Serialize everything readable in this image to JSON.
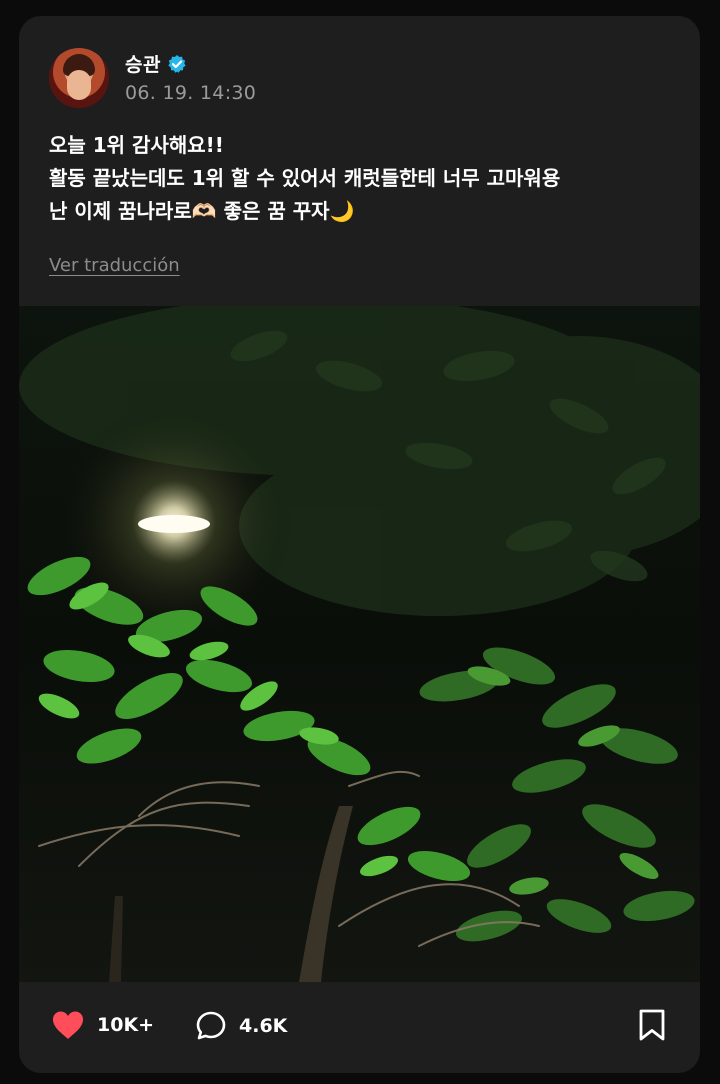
{
  "post": {
    "username": "승관",
    "verified": true,
    "timestamp": "06. 19. 14:30",
    "text_lines": [
      "오늘 1위 감사해요!!",
      "활동 끝났는데도 1위 할 수 있어서 캐럿들한테 너무 고마워용",
      "난 이제 꿈나라로🫶🏻 좋은 꿈 꾸자🌙"
    ],
    "translate_link": "Ver traducción",
    "photo_description_icon": "night-tree-lamp-photo"
  },
  "actions": {
    "like_count": "10K+",
    "comment_count": "4.6K",
    "like_icon": "heart-icon",
    "comment_icon": "comment-bubble-icon",
    "bookmark_icon": "bookmark-icon"
  },
  "colors": {
    "background": "#0b0b0b",
    "card": "#1e1e1f",
    "heart": "#ff4d5a",
    "verified": "#27b6ea",
    "muted": "#9b9b9b"
  }
}
